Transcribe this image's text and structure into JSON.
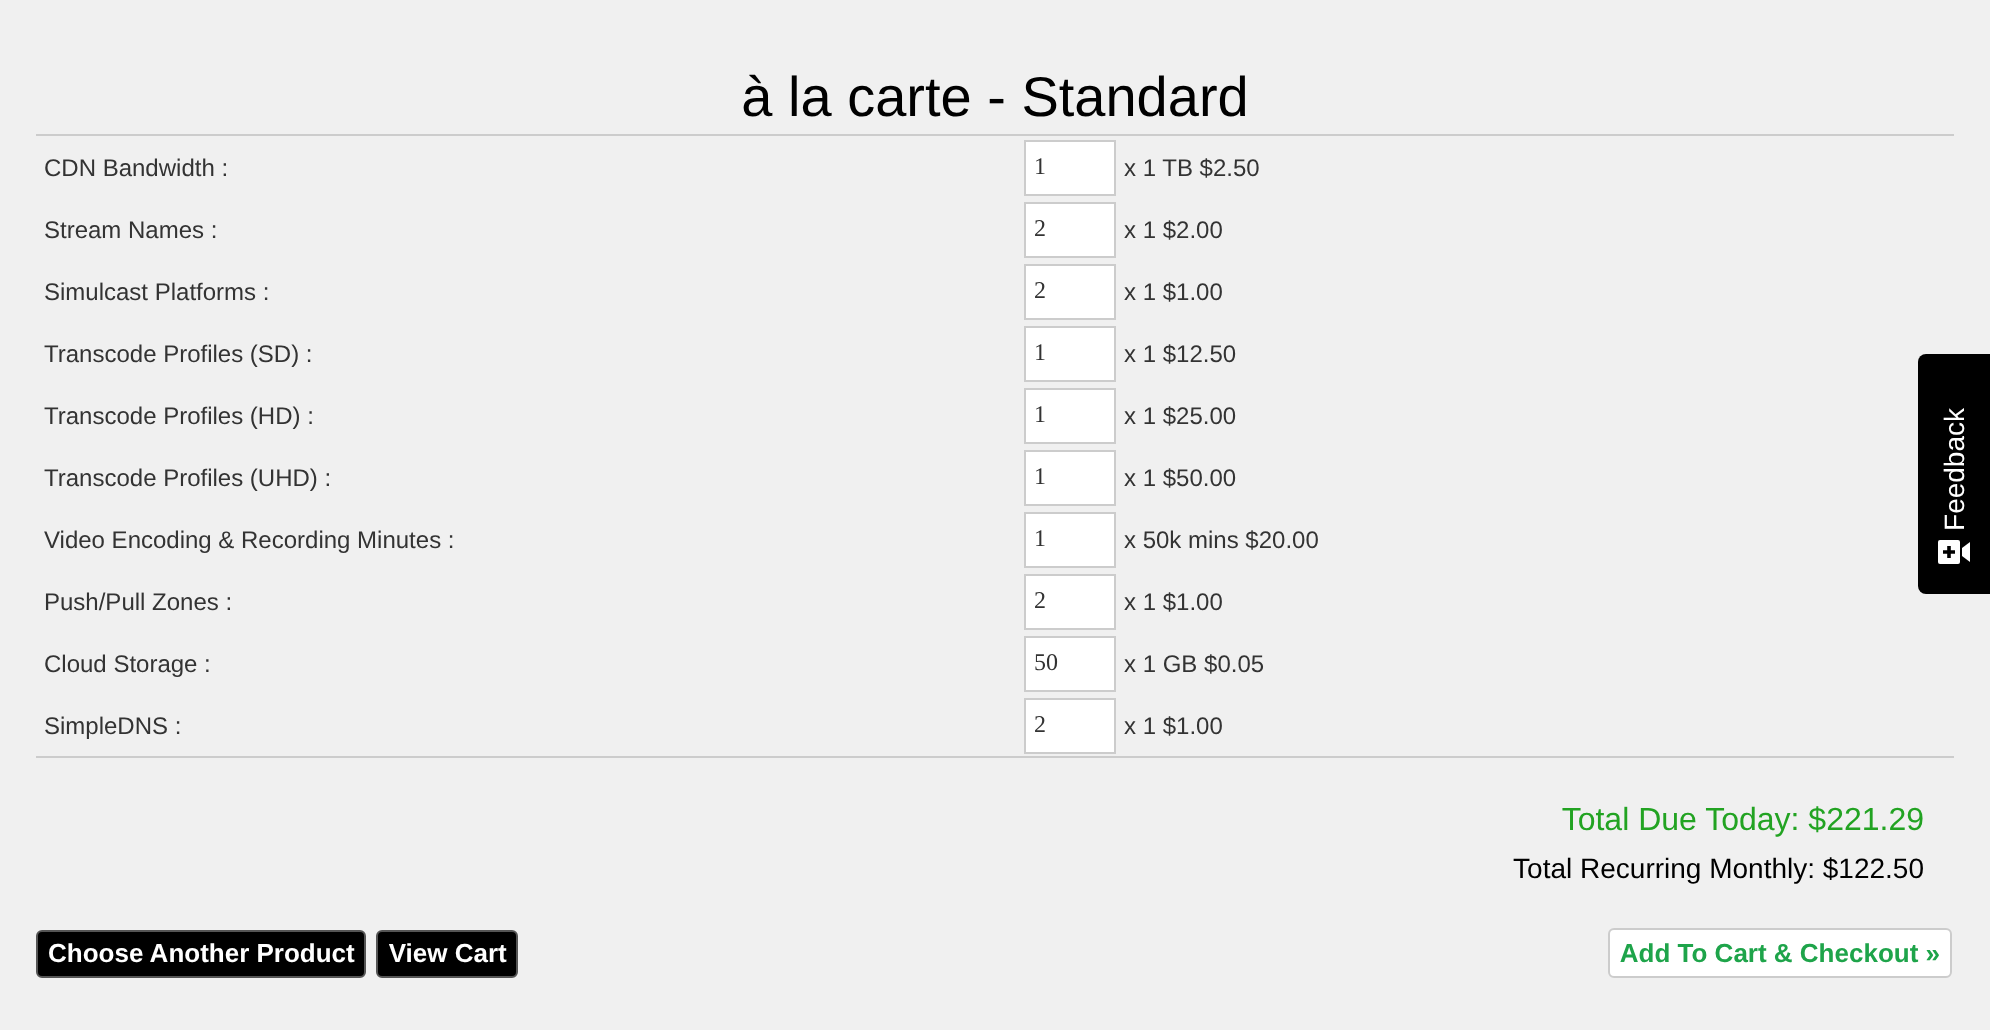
{
  "title": "à la carte - Standard",
  "items": [
    {
      "label": "CDN Bandwidth :",
      "quantity": "1",
      "unit_price": "x 1 TB $2.50"
    },
    {
      "label": "Stream Names :",
      "quantity": "2",
      "unit_price": "x 1 $2.00"
    },
    {
      "label": "Simulcast Platforms :",
      "quantity": "2",
      "unit_price": "x 1 $1.00"
    },
    {
      "label": "Transcode Profiles (SD) :",
      "quantity": "1",
      "unit_price": "x 1 $12.50"
    },
    {
      "label": "Transcode Profiles (HD) :",
      "quantity": "1",
      "unit_price": "x 1 $25.00"
    },
    {
      "label": "Transcode Profiles (UHD) :",
      "quantity": "1",
      "unit_price": "x 1 $50.00"
    },
    {
      "label": "Video Encoding & Recording Minutes :",
      "quantity": "1",
      "unit_price": "x 50k mins $20.00"
    },
    {
      "label": "Push/Pull Zones :",
      "quantity": "2",
      "unit_price": "x 1 $1.00"
    },
    {
      "label": "Cloud Storage :",
      "quantity": "50",
      "unit_price": "x 1 GB $0.05"
    },
    {
      "label": "SimpleDNS :",
      "quantity": "2",
      "unit_price": "x 1 $1.00"
    }
  ],
  "total_due_today": "Total Due Today: $221.29",
  "total_recurring_monthly": "Total Recurring Monthly: $122.50",
  "buttons": [
    "Choose Another Product",
    "View Cart"
  ],
  "checkout_button": "Add To Cart & Checkout »",
  "feedback_tab": "Feedback"
}
